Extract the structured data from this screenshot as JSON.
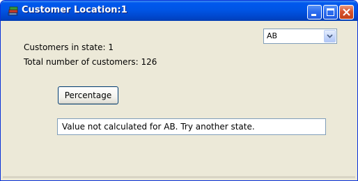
{
  "window": {
    "title": "Customer Location:1",
    "icon": "books-app-icon"
  },
  "titlebar_buttons": {
    "minimize": "minimize-icon",
    "maximize": "maximize-icon",
    "close": "close-icon"
  },
  "state_select": {
    "selected": "AB"
  },
  "labels": {
    "customers_in_state": "Customers in state: 1",
    "total_customers": "Total number of customers: 126"
  },
  "percentage_button": {
    "label": "Percentage"
  },
  "result_field": {
    "value": "Value not calculated for AB. Try another state."
  },
  "colors": {
    "titlebar": "#0055e5",
    "window_bg": "#ece9d8",
    "close_button": "#d6532e"
  }
}
